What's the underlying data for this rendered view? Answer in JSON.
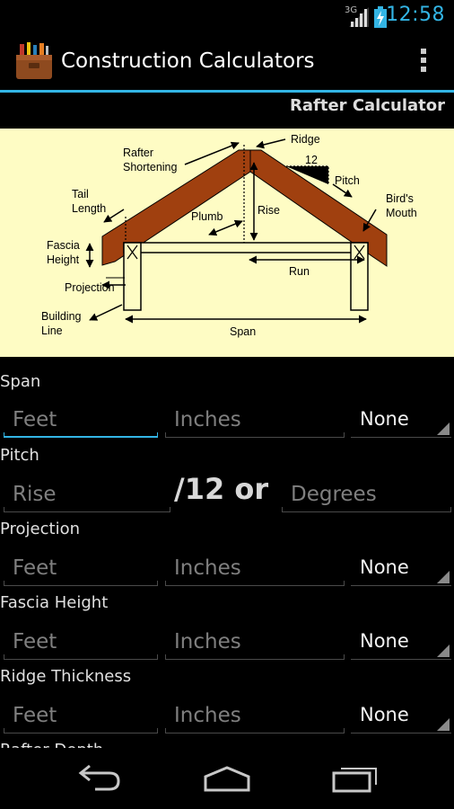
{
  "status": {
    "network": "3G",
    "time": "12:58"
  },
  "app": {
    "title": "Construction Calculators"
  },
  "screen": {
    "title": "Rafter Calculator"
  },
  "diagram": {
    "labels": {
      "rafter_shortening_1": "Rafter",
      "rafter_shortening_2": "Shortening",
      "ridge": "Ridge",
      "twelve": "12",
      "pitch": "Pitch",
      "tail_length_1": "Tail",
      "tail_length_2": "Length",
      "birds_mouth_1": "Bird's",
      "birds_mouth_2": "Mouth",
      "plumb": "Plumb",
      "rise": "Rise",
      "fascia_height_1": "Fascia",
      "fascia_height_2": "Height",
      "run": "Run",
      "projection": "Projection",
      "building_line_1": "Building",
      "building_line_2": "Line",
      "span": "Span"
    }
  },
  "form": {
    "span": {
      "label": "Span",
      "feet_placeholder": "Feet",
      "inches_placeholder": "Inches",
      "unit": "None"
    },
    "pitch": {
      "label": "Pitch",
      "rise_placeholder": "Rise",
      "separator": "/12 or",
      "degrees_placeholder": "Degrees"
    },
    "projection": {
      "label": "Projection",
      "feet_placeholder": "Feet",
      "inches_placeholder": "Inches",
      "unit": "None"
    },
    "fascia_height": {
      "label": "Fascia Height",
      "feet_placeholder": "Feet",
      "inches_placeholder": "Inches",
      "unit": "None"
    },
    "ridge_thickness": {
      "label": "Ridge Thickness",
      "feet_placeholder": "Feet",
      "inches_placeholder": "Inches",
      "unit": "None"
    },
    "rafter_depth": {
      "label": "Rafter Depth"
    }
  },
  "colors": {
    "accent": "#33b5e5",
    "diagram_bg": "#fefcc4",
    "rafter": "#a0400f"
  }
}
